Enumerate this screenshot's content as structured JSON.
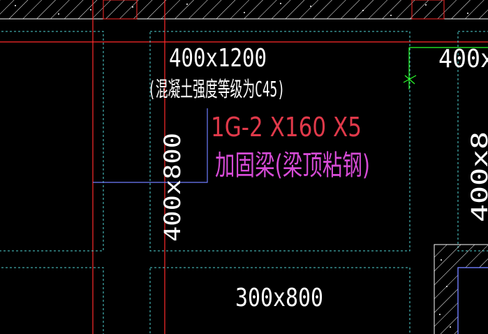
{
  "labels": {
    "beam_top": "400x1200",
    "beam_note": "(混凝土强度等级为C45)",
    "right_beam": "400x",
    "vertical_left": "400x800",
    "vertical_right": "400x8",
    "reinforce_code": "1G-2 X160 X5",
    "reinforce_desc": "加固梁(梁顶粘钢)",
    "bottom_beam": "300x800"
  },
  "colors": {
    "background": "#000000",
    "axis_red": "#ff2b2b",
    "dashed_cyan": "#4fd3d3",
    "hatch_white": "#ffffff",
    "leader_blue": "#6f7dff",
    "marker_green": "#2bff2b",
    "code_red": "#e0394a",
    "desc_magenta": "#d64bd6",
    "text_white": "#ffffff"
  }
}
